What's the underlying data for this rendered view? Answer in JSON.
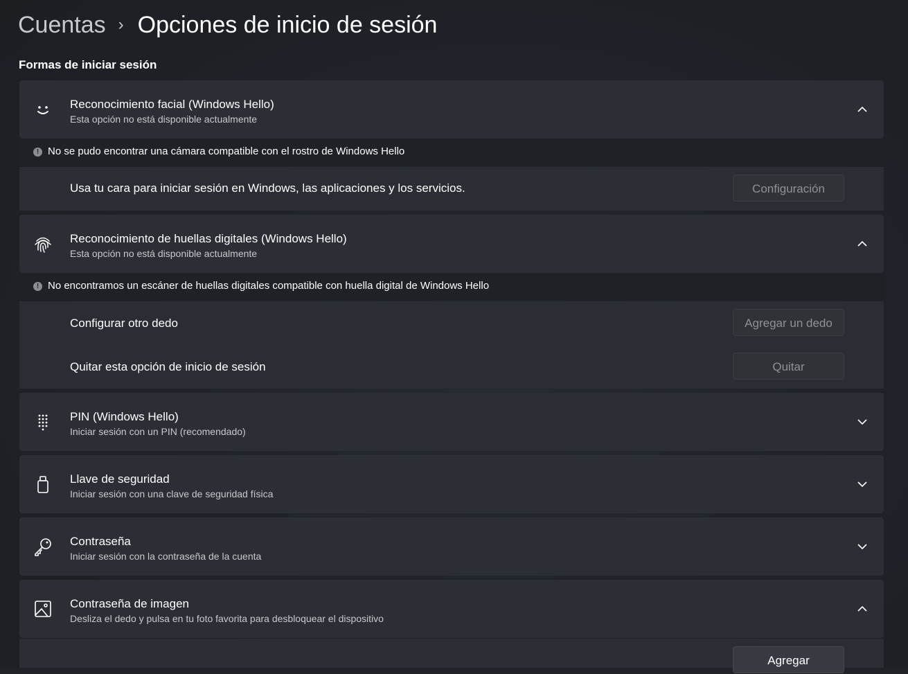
{
  "breadcrumb": {
    "parent": "Cuentas",
    "separator": "›",
    "current": "Opciones de inicio de sesión"
  },
  "section_title": "Formas de iniciar sesión",
  "face": {
    "title": "Reconocimiento facial (Windows Hello)",
    "subtitle": "Esta opción no está disponible actualmente",
    "notice": "No se pudo encontrar una cámara compatible con el rostro de Windows Hello",
    "row_label": "Usa tu cara para iniciar sesión en Windows, las aplicaciones y los servicios.",
    "button": "Configuración",
    "icon": "face-icon"
  },
  "fingerprint": {
    "title": "Reconocimiento de huellas digitales (Windows Hello)",
    "subtitle": "Esta opción no está disponible actualmente",
    "notice": "No encontramos un escáner de huellas digitales compatible con huella digital de Windows Hello",
    "rows": [
      {
        "label": "Configurar otro dedo",
        "button": "Agregar un dedo"
      },
      {
        "label": "Quitar esta opción de inicio de sesión",
        "button": "Quitar"
      }
    ],
    "icon": "fingerprint-icon"
  },
  "pin": {
    "title": "PIN (Windows Hello)",
    "subtitle": "Iniciar sesión con un PIN (recomendado)",
    "icon": "keypad-icon"
  },
  "security_key": {
    "title": "Llave de seguridad",
    "subtitle": "Iniciar sesión con una clave de seguridad física",
    "icon": "usb-key-icon"
  },
  "password": {
    "title": "Contraseña",
    "subtitle": "Iniciar sesión con la contraseña de la cuenta",
    "icon": "key-icon"
  },
  "picture_password": {
    "title": "Contraseña de imagen",
    "subtitle": "Desliza el dedo y pulsa en tu foto favorita para desbloquear el dispositivo",
    "button": "Agregar",
    "icon": "image-icon"
  }
}
